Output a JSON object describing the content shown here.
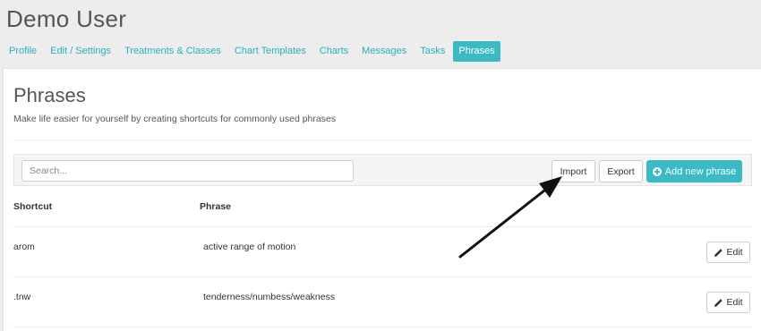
{
  "header": {
    "user_name": "Demo User",
    "tabs": [
      {
        "label": "Profile",
        "active": false
      },
      {
        "label": "Edit / Settings",
        "active": false
      },
      {
        "label": "Treatments & Classes",
        "active": false
      },
      {
        "label": "Chart Templates",
        "active": false
      },
      {
        "label": "Charts",
        "active": false
      },
      {
        "label": "Messages",
        "active": false
      },
      {
        "label": "Tasks",
        "active": false
      },
      {
        "label": "Phrases",
        "active": true
      }
    ]
  },
  "page": {
    "title": "Phrases",
    "subtitle": "Make life easier for yourself by creating shortcuts for commonly used phrases"
  },
  "toolbar": {
    "search_placeholder": "Search...",
    "search_value": "",
    "import_label": "Import",
    "export_label": "Export",
    "add_label": "Add new phrase",
    "add_icon": "plus-circle-icon"
  },
  "table": {
    "columns": [
      "Shortcut",
      "Phrase"
    ],
    "rows": [
      {
        "shortcut": "arom",
        "phrase": "active range of motion",
        "edit_label": "Edit"
      },
      {
        "shortcut": ".tnw",
        "phrase": "tenderness/numbess/weakness",
        "edit_label": "Edit"
      }
    ],
    "edit_icon": "pencil-icon"
  },
  "colors": {
    "accent": "#3bbac6",
    "tab_text": "#2bb0bd",
    "background": "#ededed",
    "panel": "#ffffff"
  }
}
